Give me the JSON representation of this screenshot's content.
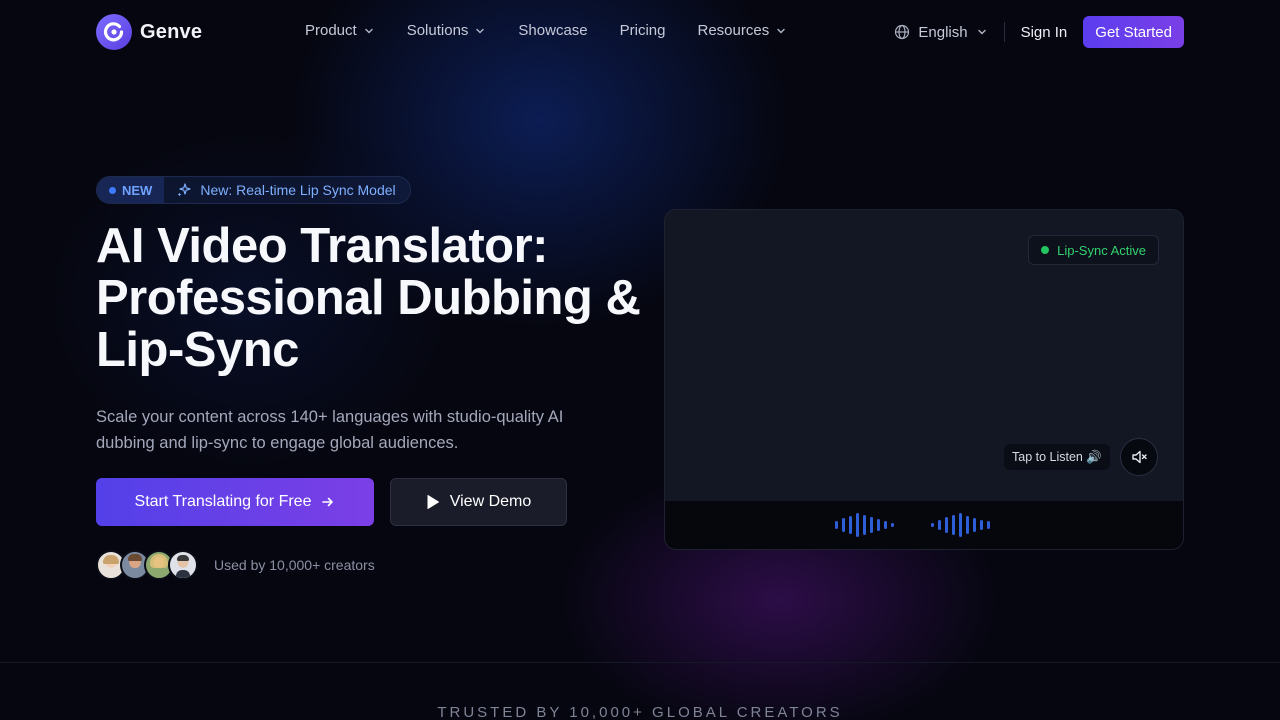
{
  "brand": {
    "name": "Genve",
    "accent": "#6a4cf0"
  },
  "nav": {
    "items": [
      {
        "label": "Product",
        "dropdown": true
      },
      {
        "label": "Solutions",
        "dropdown": true
      },
      {
        "label": "Showcase",
        "dropdown": false
      },
      {
        "label": "Pricing",
        "dropdown": false
      },
      {
        "label": "Resources",
        "dropdown": true
      }
    ],
    "language": "English",
    "sign_in": "Sign In",
    "get_started": "Get Started"
  },
  "badge": {
    "tag": "NEW",
    "text": "New: Real-time Lip Sync Model"
  },
  "hero": {
    "headline_lines": [
      "AI Video Translator:",
      "Professional Dubbing &",
      "Lip-Sync"
    ],
    "subtitle": "Scale your content across 140+ languages with studio-quality AI dubbing and lip-sync to engage global audiences.",
    "cta_primary": "Start Translating for Free",
    "cta_secondary": "View Demo",
    "social_proof": "Used by 10,000+ creators"
  },
  "video": {
    "status": "Lip-Sync Active",
    "status_color": "#22c55e",
    "tap_to_listen": "Tap to Listen 🔊"
  },
  "trusted": "TRUSTED BY 10,000+ GLOBAL CREATORS"
}
